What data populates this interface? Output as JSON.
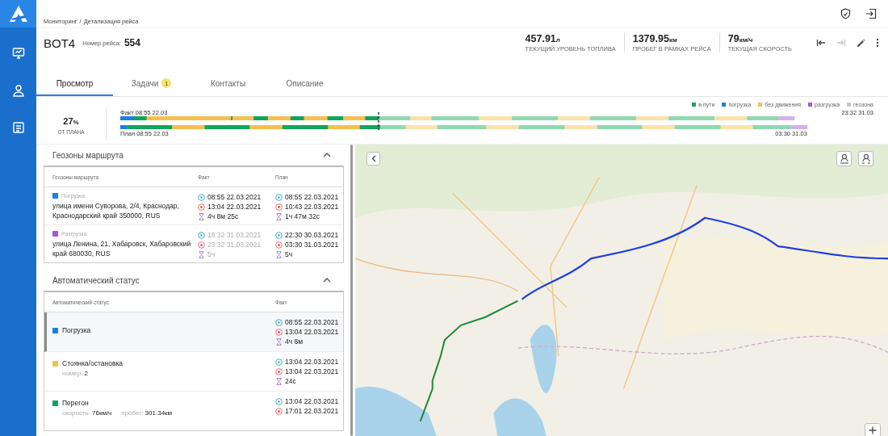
{
  "sidebar": {
    "items": [
      {
        "kind": "monitor"
      },
      {
        "kind": "driver"
      },
      {
        "kind": "list"
      }
    ]
  },
  "breadcrumb": {
    "items": [
      "Мониторинг",
      "Детализация рейса"
    ],
    "separator": "/"
  },
  "header_actions": [
    {
      "kind": "shield"
    },
    {
      "kind": "logout"
    }
  ],
  "vehicle": {
    "name": "BOT4",
    "trip_label": "Номер рейса:",
    "trip_number": "554"
  },
  "stats": [
    {
      "value": "457.91",
      "unit": "л",
      "label": "ТЕКУЩИЙ УРОВЕНЬ ТОПЛИВА"
    },
    {
      "value": "1379.95",
      "unit": "км",
      "label": "ПРОБЕГ В РАМКАХ РЕЙСА"
    },
    {
      "value": "79",
      "unit": "км/ч",
      "label": "ТЕКУЩАЯ СКОРОСТЬ"
    }
  ],
  "toolbar": [
    {
      "kind": "first",
      "disabled": false
    },
    {
      "kind": "last",
      "disabled": true
    },
    {
      "kind": "edit",
      "disabled": false
    },
    {
      "kind": "more",
      "disabled": false
    }
  ],
  "tabs": [
    {
      "label": "Просмотр",
      "selected": true
    },
    {
      "label": "Задачи",
      "selected": false,
      "badge": "1"
    },
    {
      "label": "Контакты",
      "selected": false
    },
    {
      "label": "Описание",
      "selected": false
    }
  ],
  "progress": {
    "value": "27",
    "unit": "%",
    "label": "ОТ ПЛАНА"
  },
  "timeline": {
    "legend": [
      {
        "label": "в пути",
        "color": "#10a65b"
      },
      {
        "label": "погрузка",
        "color": "#1a7fe6"
      },
      {
        "label": "без движения",
        "color": "#f6c04e"
      },
      {
        "label": "разгрузка",
        "color": "#a259e0"
      },
      {
        "label": "геозона",
        "color": "#c8c8c8"
      }
    ],
    "fact": {
      "start_label": "Факт 08:55 22.03",
      "end_label": "23:32 31.03"
    },
    "plan": {
      "start_label": "План 08:55 22.03",
      "end_label": "03:30 31.03"
    }
  },
  "geozones": {
    "title": "Геозоны маршрута",
    "expanded": true,
    "columns": [
      "Геозоны маршрута",
      "Факт",
      "План"
    ],
    "rows": [
      {
        "type": "Погрузка",
        "color": "#1a7fe6",
        "address": "улица имени Суворова, 2/4, Краснодар, Краснодарский край 350000, RUS",
        "fact": {
          "start": "08:55 22.03.2021",
          "end": "13:04 22.03.2021",
          "duration": "4ч 8м 25с",
          "estimated": false
        },
        "plan": {
          "start": "08:55 22.03.2021",
          "end": "10:43 22.03.2021",
          "duration": "1ч 47м 32с",
          "estimated": false
        }
      },
      {
        "type": "Разгрузка",
        "color": "#a259e0",
        "address": "улица Ленина, 21, Хабаровск, Хабаровский край 680030, RUS",
        "fact": {
          "start": "18:32 31.03.2021",
          "end": "23:32 31.03.2021",
          "duration": "5ч",
          "estimated": true
        },
        "plan": {
          "start": "22:30 30.03.2021",
          "end": "03:30 31.03.2021",
          "duration": "5ч",
          "estimated": false
        }
      }
    ]
  },
  "auto_status": {
    "title": "Автоматический статус",
    "expanded": true,
    "columns": [
      "Автоматический статус",
      "Факт"
    ],
    "rows": [
      {
        "name": "Погрузка",
        "color": "#1a7fe6",
        "selected": true,
        "details": [],
        "times": {
          "start": "08:55 22.03.2021",
          "end": "13:04 22.03.2021",
          "duration": "4ч 8м"
        }
      },
      {
        "name": "Стоянка/остановка",
        "color": "#f6c04e",
        "selected": false,
        "details": [
          {
            "label": "номер:",
            "value": "2"
          }
        ],
        "times": {
          "start": "13:04 22.03.2021",
          "end": "13:04 22.03.2021",
          "duration": "24с"
        }
      },
      {
        "name": "Перегон",
        "color": "#10a65b",
        "selected": false,
        "details": [
          {
            "label": "скорость:",
            "value": "76км/ч"
          },
          {
            "label": "пробег:",
            "value": "301.34км"
          }
        ],
        "times": {
          "start": "13:04 22.03.2021",
          "end": "17:01 22.03.2021"
        }
      }
    ]
  },
  "map": {
    "kind": "picture",
    "controls": [
      {
        "kind": "collapse"
      },
      {
        "kind": "driver-location"
      },
      {
        "kind": "driver-route"
      },
      {
        "kind": "zoom-in"
      }
    ]
  }
}
